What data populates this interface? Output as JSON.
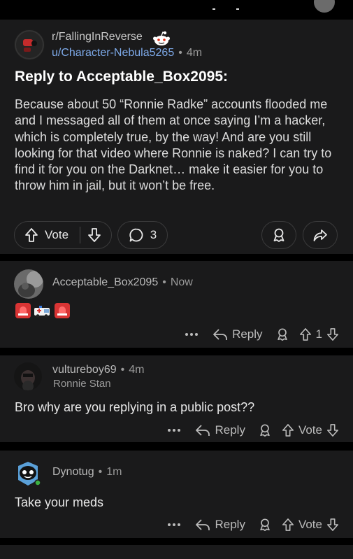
{
  "post": {
    "subreddit": "r/FallingInReverse",
    "author": "u/Character-Nebula5265",
    "time": "4m",
    "title": "Reply to Acceptable_Box2095:",
    "body": "Because about 50 “Ronnie Radke” accounts flooded me and I messaged all of them at once saying I’m a hacker, which is completely true, by the way! And are you still looking for that video where Ronnie is naked? I can try to find it for you on the Darknet… make it easier for you to throw him in jail, but it won’t be free.",
    "vote_label": "Vote",
    "comment_count": "3"
  },
  "comments": [
    {
      "author": "Acceptable_Box2095",
      "time": "Now",
      "flair": "",
      "text": "",
      "emojis": [
        "rotating-light",
        "ambulance",
        "rotating-light"
      ],
      "reply_label": "Reply",
      "score": "1"
    },
    {
      "author": "vultureboy69",
      "time": "4m",
      "flair": "Ronnie Stan",
      "text": "Bro why are you replying in a public post??",
      "reply_label": "Reply",
      "score": "Vote"
    },
    {
      "author": "Dynotug",
      "time": "1m",
      "flair": "",
      "text": "Take your meds",
      "reply_label": "Reply",
      "score": "Vote"
    }
  ],
  "icons": {
    "upvote": "arrow-up-icon",
    "downvote": "arrow-down-icon",
    "comment": "speech-bubble-icon",
    "award": "award-icon",
    "share": "share-arrow-icon",
    "reply": "reply-arrow-icon",
    "more": "ellipsis-icon"
  },
  "colors": {
    "background": "#000000",
    "card": "#1a1a1b",
    "link": "#7da9e8",
    "text": "#e8e8e8"
  }
}
